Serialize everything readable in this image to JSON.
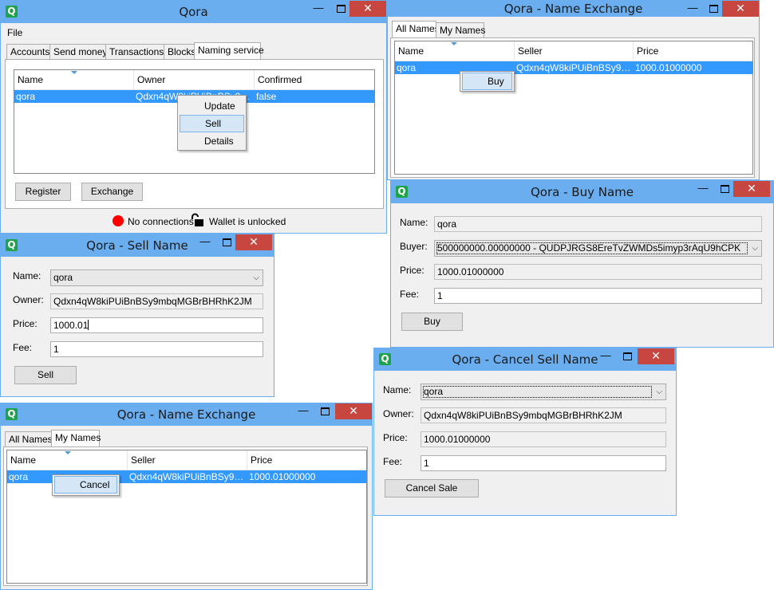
{
  "main": {
    "title": "Qora",
    "menu_file": "File",
    "tabs": [
      "Accounts",
      "Send money",
      "Transactions",
      "Blocks",
      "Naming service"
    ],
    "columns": [
      "Name",
      "Owner",
      "Confirmed"
    ],
    "row": {
      "name": "qora",
      "owner": "Qdxn4qW8kiPUiBnBSy9mbqMGBrBHRhK2JM",
      "confirmed": "false"
    },
    "context_menu": [
      "Update",
      "Sell",
      "Details"
    ],
    "register_label": "Register",
    "exchange_label": "Exchange",
    "status_connections": "No connections",
    "status_wallet": "Wallet is unlocked"
  },
  "exchange_all": {
    "title": "Qora - Name Exchange",
    "tabs": [
      "All Names",
      "My Names"
    ],
    "columns": [
      "Name",
      "Seller",
      "Price"
    ],
    "row": {
      "name": "qora",
      "seller": "Qdxn4qW8kiPUiBnBSy9mbq…",
      "price": "1000.01000000"
    },
    "context_item": "Buy"
  },
  "buy": {
    "title": "Qora - Buy Name",
    "name_label": "Name:",
    "name_value": "qora",
    "buyer_label": "Buyer:",
    "buyer_value": "500000000.00000000 - QUDPJRGS8EreTvZWMDs5imyp3rAqU9hCPK",
    "price_label": "Price:",
    "price_value": "1000.01000000",
    "fee_label": "Fee:",
    "fee_value": "1",
    "button": "Buy"
  },
  "sell": {
    "title": "Qora - Sell Name",
    "name_label": "Name:",
    "name_value": "qora",
    "owner_label": "Owner:",
    "owner_value": "Qdxn4qW8kiPUiBnBSy9mbqMGBrBHRhK2JM",
    "price_label": "Price:",
    "price_value": "1000.01",
    "fee_label": "Fee:",
    "fee_value": "1",
    "button": "Sell"
  },
  "exchange_my": {
    "title": "Qora - Name Exchange",
    "tabs": [
      "All Names",
      "My Names"
    ],
    "columns": [
      "Name",
      "Seller",
      "Price"
    ],
    "row": {
      "name": "qora",
      "seller": "Qdxn4qW8kiPUiBnBSy9mbq…",
      "price": "1000.01000000"
    },
    "context_item": "Cancel"
  },
  "cancel": {
    "title": "Qora - Cancel Sell Name",
    "name_label": "Name:",
    "name_value": "qora",
    "owner_label": "Owner:",
    "owner_value": "Qdxn4qW8kiPUiBnBSy9mbqMGBrBHRhK2JM",
    "price_label": "Price:",
    "price_value": "1000.01000000",
    "fee_label": "Fee:",
    "fee_value": "1",
    "button": "Cancel Sale"
  },
  "window_controls": {
    "minimize": "—",
    "close": "✕",
    "combo_arrow": "⌵",
    "app_icon": "Q"
  },
  "colors": {
    "titlebar": "#6aaef0",
    "close": "#c7463f",
    "selection": "#3399ff",
    "status_dot": "#ff0000"
  }
}
